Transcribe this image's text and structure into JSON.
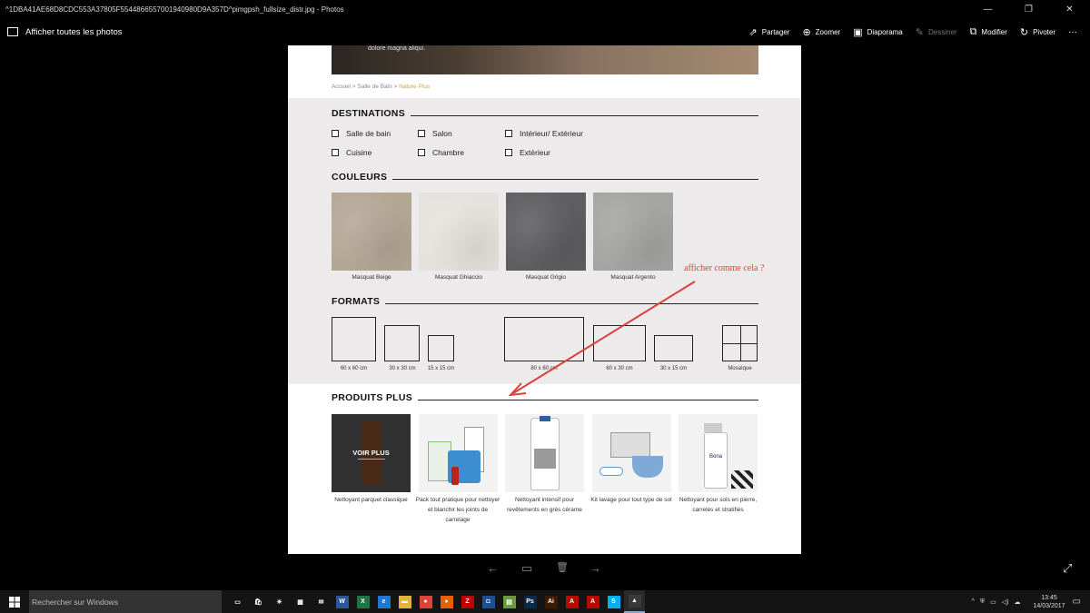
{
  "window": {
    "title": "^1DBA41AE68D8CDC553A37805F5544866557001940980D9A357D^pimgpsh_fullsize_distr.jpg - Photos",
    "min": "—",
    "max": "❐",
    "close": "✕"
  },
  "appbar": {
    "all_photos": "Afficher toutes les photos",
    "tools": [
      {
        "icon": "share-icon",
        "glyph": "⇗",
        "label": "Partager",
        "enabled": true
      },
      {
        "icon": "zoom-icon",
        "glyph": "⊕",
        "label": "Zoomer",
        "enabled": true
      },
      {
        "icon": "slideshow-icon",
        "glyph": "▣",
        "label": "Diaporama",
        "enabled": true
      },
      {
        "icon": "draw-icon",
        "glyph": "✎",
        "label": "Dessiner",
        "enabled": false
      },
      {
        "icon": "edit-icon",
        "glyph": "⧉",
        "label": "Modifier",
        "enabled": true
      },
      {
        "icon": "rotate-icon",
        "glyph": "↻",
        "label": "Pivoter",
        "enabled": true
      }
    ],
    "more": "···"
  },
  "doc": {
    "hero_caption": "dolore magna aliqui.",
    "breadcrumb": {
      "home": "Accueil",
      "sep1": " > ",
      "cat": "Salle de Bain",
      "sep2": " > ",
      "current": "Nature Plus"
    },
    "destinations": {
      "title": "DESTINATIONS",
      "items": [
        "Salle de bain",
        "Salon",
        "Intérieur/ Extérieur",
        "Cuisine",
        "Chambre",
        "Extérieur"
      ]
    },
    "couleurs": {
      "title": "COULEURS",
      "items": [
        {
          "label": "Masquat Beige",
          "color": "#b3a794"
        },
        {
          "label": "Masquat Ghiaccio",
          "color": "#e4e2dc"
        },
        {
          "label": "Masquat Grigio",
          "color": "#5e5e60"
        },
        {
          "label": "Masquat Argento",
          "color": "#a4a4a3"
        }
      ]
    },
    "formats": {
      "title": "FORMATS",
      "items": [
        "60 x 60 cm",
        "30 x 30 cm",
        "15 x 15 cm",
        "80 x 60 cm",
        "60 x 30 cm",
        "30 x 15 cm",
        "Mosaïque"
      ]
    },
    "produits": {
      "title": "PRODUITS PLUS",
      "voir_plus": "VOIR PLUS",
      "items": [
        {
          "label": "Nettoyant parquet classique"
        },
        {
          "label": "Pack tout pratique pour nettoyer et blanchir les joints de carrelage"
        },
        {
          "label": "Nettoyant intensif pour revêtements en grès cérame"
        },
        {
          "label": "Kit lavage pour tout type de sol"
        },
        {
          "label": "Nettoyant pour sols en pierre, carrelés et stratifiés"
        }
      ],
      "bona": "Bona"
    }
  },
  "annotation": {
    "text": "afficher comme cela ?",
    "color": "#d9413a"
  },
  "viewer_nav": {
    "prev": "←",
    "slideshow": "▭",
    "delete": "🗑",
    "next": "→",
    "fullscreen": "⤢"
  },
  "taskbar": {
    "search_placeholder": "Rechercher sur Windows",
    "apps": [
      {
        "name": "task-view-icon",
        "glyph": "▭",
        "color": "transparent"
      },
      {
        "name": "store-icon",
        "glyph": "🛍",
        "color": "transparent"
      },
      {
        "name": "weather-icon",
        "glyph": "☀",
        "color": "transparent"
      },
      {
        "name": "calculator-icon",
        "glyph": "▦",
        "color": "transparent"
      },
      {
        "name": "mail-icon",
        "glyph": "✉",
        "color": "transparent"
      },
      {
        "name": "word-icon",
        "glyph": "W",
        "color": "#2b579a"
      },
      {
        "name": "excel-icon",
        "glyph": "X",
        "color": "#217346"
      },
      {
        "name": "edge-icon",
        "glyph": "e",
        "color": "#1e78d2"
      },
      {
        "name": "explorer-icon",
        "glyph": "▬",
        "color": "#e2b33a"
      },
      {
        "name": "chrome-icon",
        "glyph": "●",
        "color": "#db4437"
      },
      {
        "name": "firefox-icon",
        "glyph": "●",
        "color": "#e66000"
      },
      {
        "name": "filezilla-icon",
        "glyph": "Z",
        "color": "#bf0000"
      },
      {
        "name": "app-icon",
        "glyph": "◘",
        "color": "#1d4f91"
      },
      {
        "name": "notepad-icon",
        "glyph": "▤",
        "color": "#6b9a3c"
      },
      {
        "name": "photoshop-icon",
        "glyph": "Ps",
        "color": "#0b2a48"
      },
      {
        "name": "illustrator-icon",
        "glyph": "Ai",
        "color": "#3c1b00"
      },
      {
        "name": "acrobat-icon",
        "glyph": "A",
        "color": "#b30b00"
      },
      {
        "name": "acrobat-reader-icon",
        "glyph": "A",
        "color": "#b30b00"
      },
      {
        "name": "skype-icon",
        "glyph": "S",
        "color": "#00aff0"
      },
      {
        "name": "photos-icon",
        "glyph": "▲",
        "color": "#3a3a3a"
      }
    ],
    "time": "13:45",
    "date": "14/03/2017"
  }
}
